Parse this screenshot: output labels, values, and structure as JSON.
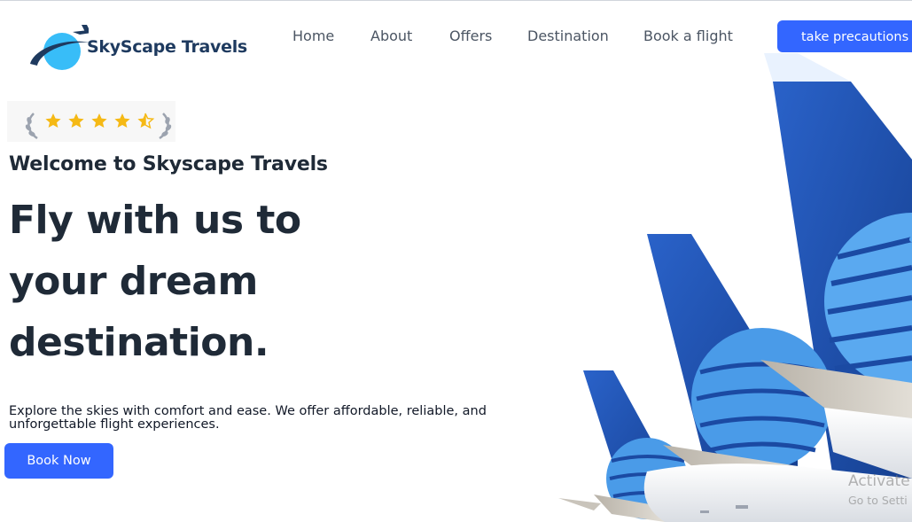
{
  "logo": {
    "text": "SkyScape Travels",
    "icon": "airplane-globe-logo"
  },
  "nav": {
    "items": [
      {
        "label": "Home"
      },
      {
        "label": "About"
      },
      {
        "label": "Offers"
      },
      {
        "label": "Destination"
      },
      {
        "label": "Book a flight"
      }
    ],
    "cta_label": "take precautions"
  },
  "hero": {
    "rating": {
      "stars": 4.5,
      "max": 5,
      "icon": "laurel-star-rating-icon"
    },
    "welcome": "Welcome to Skyscape Travels",
    "headline_lines": [
      "Fly with us to",
      "your dream",
      "destination."
    ],
    "description": "Explore the skies with comfort and ease. We offer affordable, reliable, and unforgettable flight experiences.",
    "button_label": "Book Now",
    "image": "airplane-tails-image"
  },
  "watermark": {
    "line1": "Activate",
    "line2": "Go to Setti"
  },
  "colors": {
    "accent": "#3366ff",
    "heading": "#1f2a37",
    "nav_text": "#4b5563",
    "tail_blue": "#1f4fa8"
  }
}
